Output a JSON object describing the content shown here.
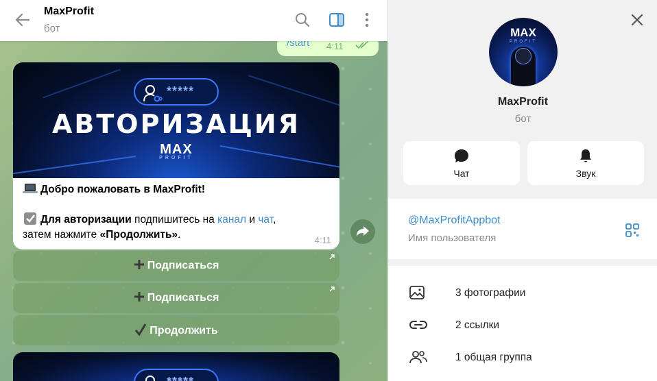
{
  "chat": {
    "title": "MaxProfit",
    "subtitle": "бот",
    "outgoing": {
      "text": "/start",
      "time": "4:11"
    },
    "message": {
      "banner_title": "АВТОРИЗАЦИЯ",
      "banner_mask": "*****",
      "banner_logo": "MAX",
      "banner_logo_sub": "PROFIT",
      "line1": "Добро пожаловать в MaxProfit!",
      "line2_bold": "Для авторизации",
      "line2_rest": "  подпишитесь на ",
      "link_channel": "канал",
      "conj": " и ",
      "link_chat": "чат",
      "comma": ",",
      "line3_pre": "затем нажмите ",
      "line3_bold": "«Продолжить»",
      "line3_end": ".",
      "time": "4:11"
    },
    "buttons": [
      {
        "label": "Подписаться",
        "icon": "plus-icon"
      },
      {
        "label": "Подписаться",
        "icon": "plus-icon"
      },
      {
        "label": "Продолжить",
        "icon": "checkmark-icon"
      }
    ]
  },
  "panel": {
    "name": "MaxProfit",
    "subtitle": "бот",
    "avatar_logo": "MAX",
    "avatar_logo_sub": "PROFIT",
    "actions": [
      {
        "label": "Чат",
        "icon": "chat-bubble-icon"
      },
      {
        "label": "Звук",
        "icon": "bell-icon"
      }
    ],
    "username": "@MaxProfitAppbot",
    "username_label": "Имя пользователя",
    "media": [
      {
        "label": "3 фотографии",
        "icon": "photo-icon"
      },
      {
        "label": "2 ссылки",
        "icon": "link-icon"
      },
      {
        "label": "1 общая группа",
        "icon": "group-icon"
      }
    ]
  },
  "colors": {
    "accent": "#3d8dcc",
    "out_bubble": "#e3fdcc",
    "panel_bg": "#f1f1f1"
  }
}
